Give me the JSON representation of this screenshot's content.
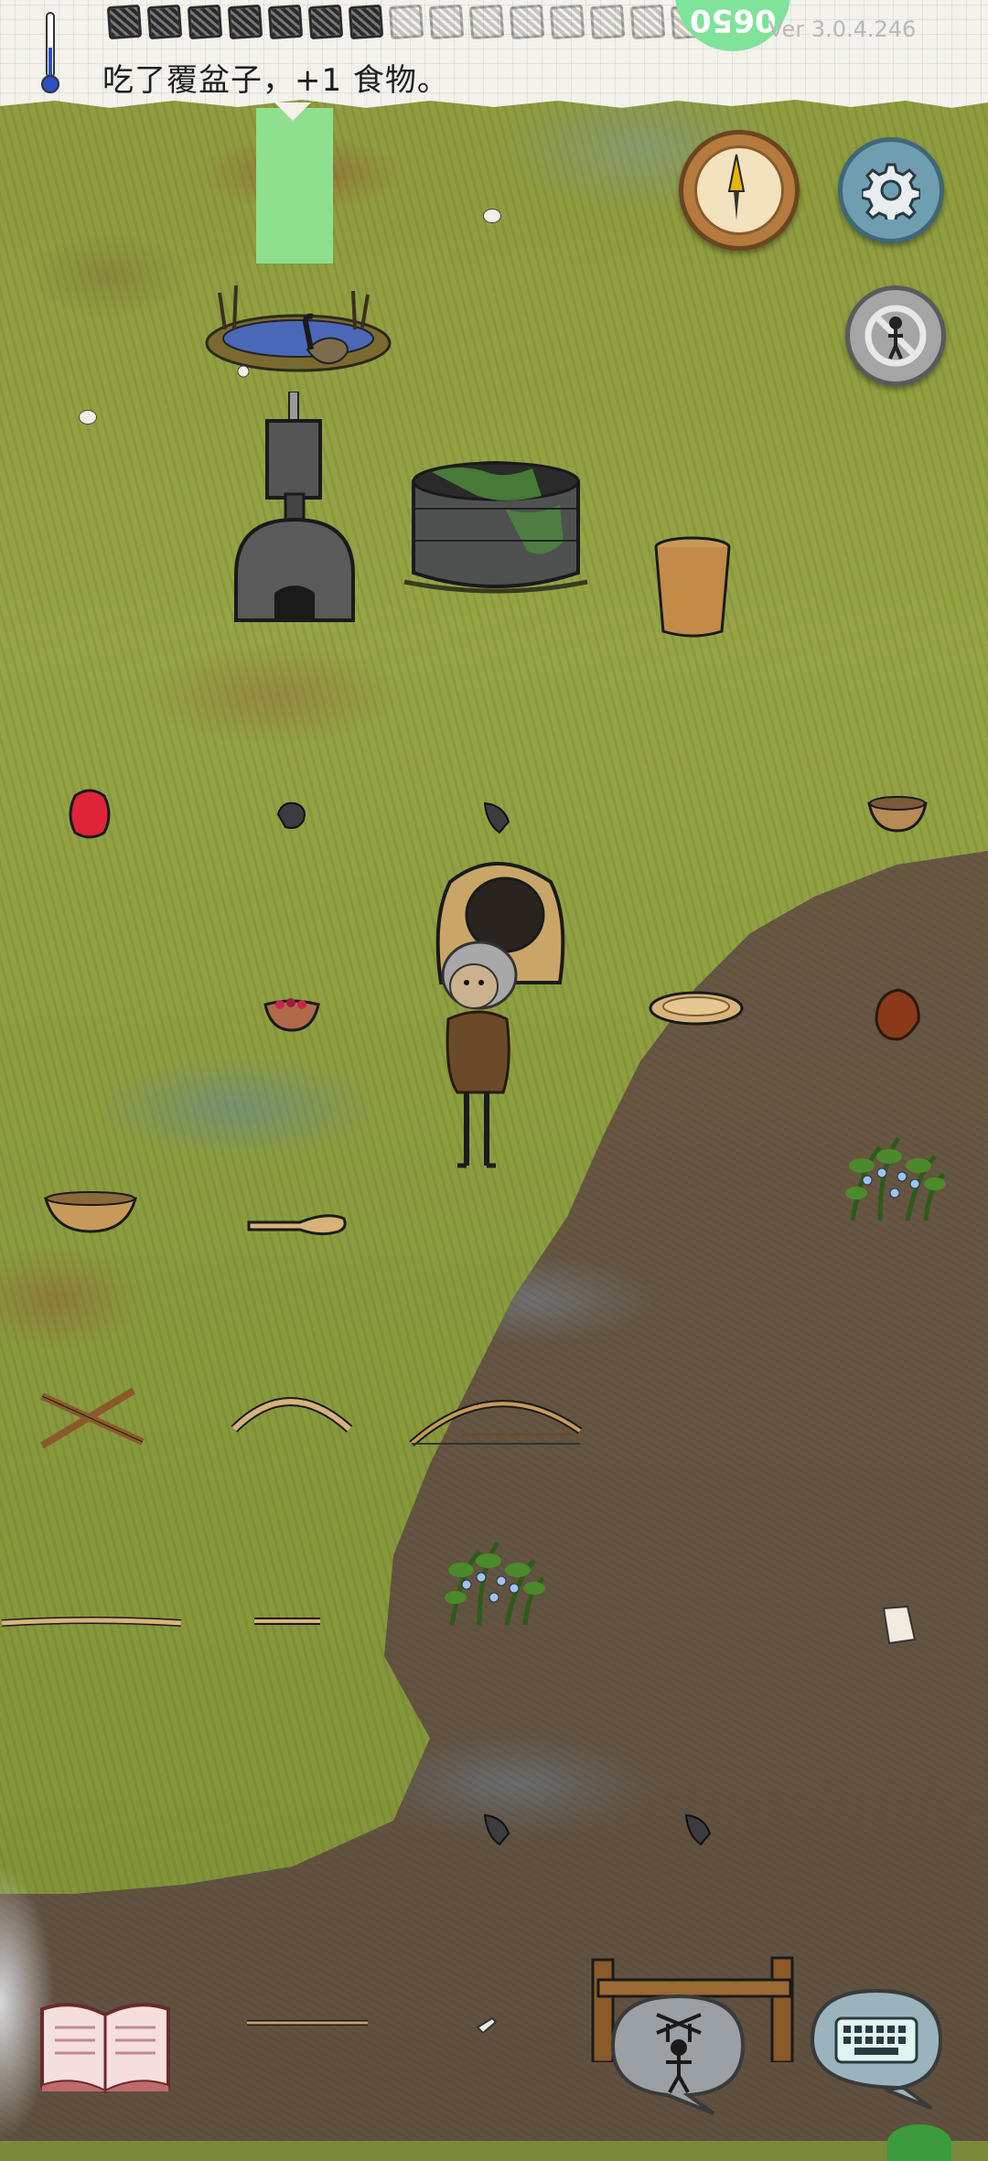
{
  "hud": {
    "message": "吃了覆盆子，+1 食物。",
    "version": "Ver 3.0.4.246",
    "yum_text": "0650",
    "food_pips": {
      "filled": 7,
      "total": 16
    }
  },
  "icons": {
    "thermometer": "thermometer-icon",
    "compass": "compass-icon",
    "settings": "gear-icon",
    "no_follow": "no-follow-icon",
    "book": "book-icon",
    "emote": "puppet-icon",
    "keyboard": "keyboard-icon"
  },
  "colors": {
    "grass": "#8e9a3e",
    "dirt": "#6d5c44",
    "paper": "#f4f2ea",
    "yum_green": "#7fe39a",
    "tag_green": "#8ee08f",
    "settings_blue": "#6f9eb1",
    "compass_brown": "#b47a3e"
  }
}
